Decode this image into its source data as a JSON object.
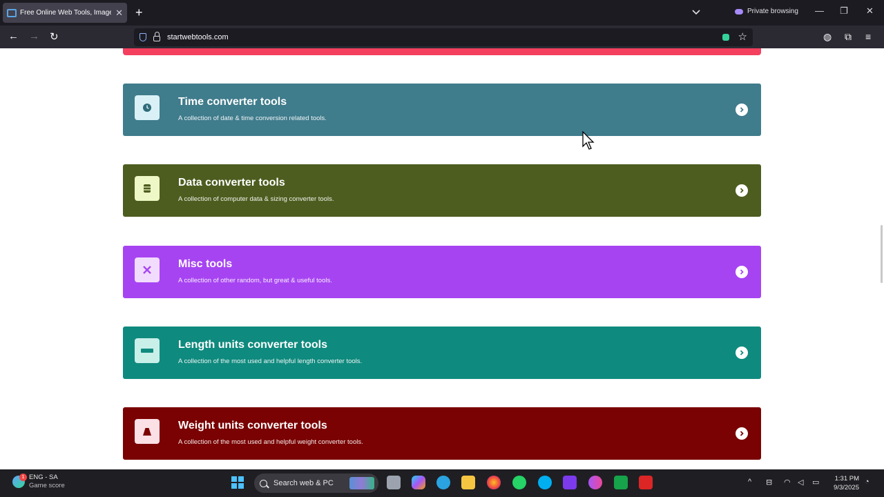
{
  "browser": {
    "tab_title": "Free Online Web Tools, Image I",
    "private_label": "Private browsing",
    "url": "startwebtools.com"
  },
  "cards": [
    {
      "title": "Time converter tools",
      "desc": "A collection of date & time conversion related tools.",
      "bg": "#3f7c8c",
      "icon_bg": "#d9f1f6",
      "icon_color": "#2f6b7a",
      "icon": "clock-icon"
    },
    {
      "title": "Data converter tools",
      "desc": "A collection of computer data & sizing converter tools.",
      "bg": "#4d5d1f",
      "icon_bg": "#eef7c6",
      "icon_color": "#4d5d1f",
      "icon": "database-icon"
    },
    {
      "title": "Misc tools",
      "desc": "A collection of other random, but great & useful tools.",
      "bg": "#a744f2",
      "icon_bg": "#f1dcfd",
      "icon_color": "#a744f2",
      "icon": "tools-icon"
    },
    {
      "title": "Length units converter tools",
      "desc": "A collection of the most used and helpful length converter tools.",
      "bg": "#0f8a7e",
      "icon_bg": "#c9efe9",
      "icon_color": "#0f8a7e",
      "icon": "ruler-icon"
    },
    {
      "title": "Weight units converter tools",
      "desc": "A collection of the most used and helpful weight converter tools.",
      "bg": "#7a0202",
      "icon_bg": "#fbe0e6",
      "icon_color": "#7a0202",
      "icon": "weight-icon"
    }
  ],
  "taskbar": {
    "weather_line1": "ENG - SA",
    "weather_line2": "Game score",
    "weather_badge": "1",
    "search_placeholder": "Search web & PC",
    "time": "1:31 PM",
    "date": "9/3/2025"
  }
}
